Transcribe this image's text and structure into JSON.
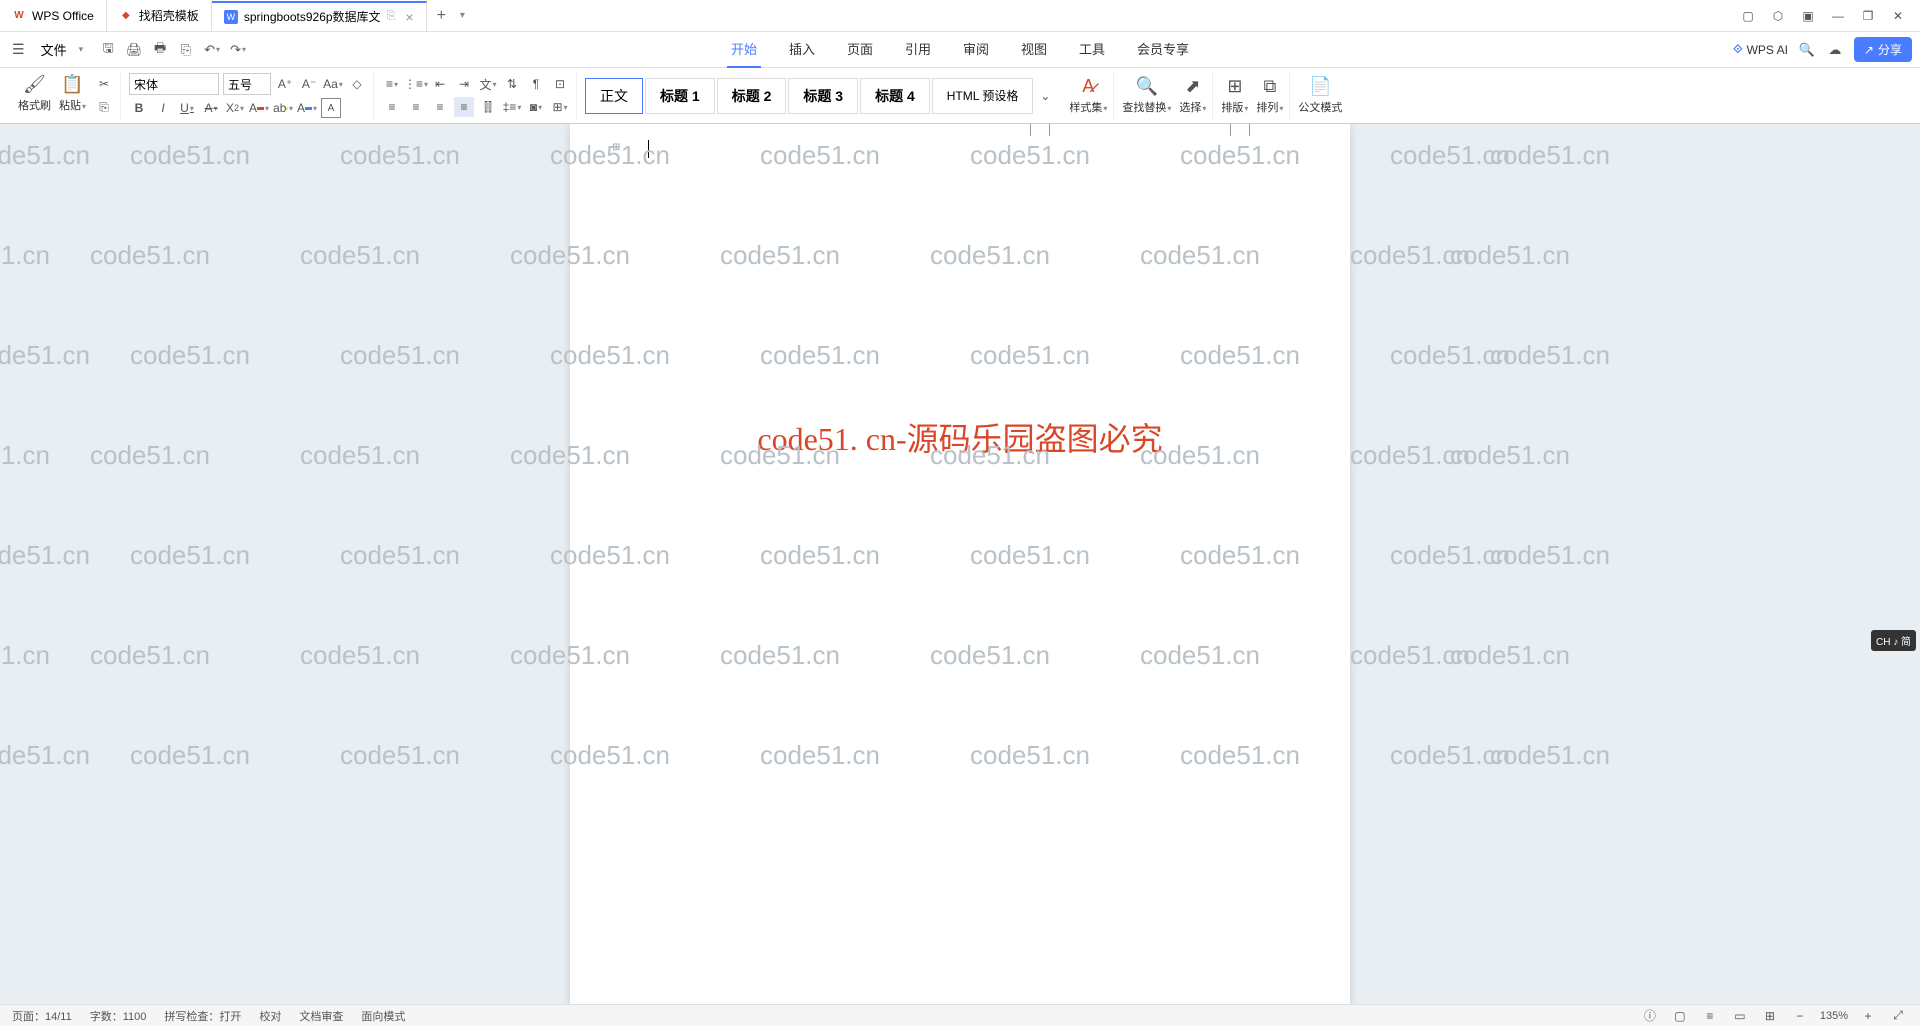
{
  "tabs": {
    "app": "WPS Office",
    "template": "找稻壳模板",
    "doc": "springboots926p数据库文",
    "docPrefix": "W"
  },
  "fileMenu": "文件",
  "menuTabs": [
    "开始",
    "插入",
    "页面",
    "引用",
    "审阅",
    "视图",
    "工具",
    "会员专享"
  ],
  "wpsAi": "WPS AI",
  "share": "分享",
  "ribbon": {
    "formatPainter": "格式刷",
    "paste": "粘贴",
    "font": "宋体",
    "fontSize": "五号",
    "styles": {
      "normal": "正文",
      "h1": "标题 1",
      "h2": "标题 2",
      "h3": "标题 3",
      "h4": "标题 4",
      "html": "HTML 预设格"
    },
    "styleSet": "样式集",
    "findReplace": "查找替换",
    "select": "选择",
    "layout": "排版",
    "arrange": "排列",
    "docMode": "公文模式"
  },
  "document": {
    "mainText": "code51. cn-源码乐园盗图必究",
    "watermark": "code51.cn"
  },
  "statusbar": {
    "page": "页面：14/11",
    "words": "字数：1100",
    "spell": "拼写检查：打开",
    "proof": "校对",
    "docCheck": "文档审查",
    "readMode": "面向模式",
    "zoom": "135%"
  },
  "ime": "CH ♪ 简"
}
